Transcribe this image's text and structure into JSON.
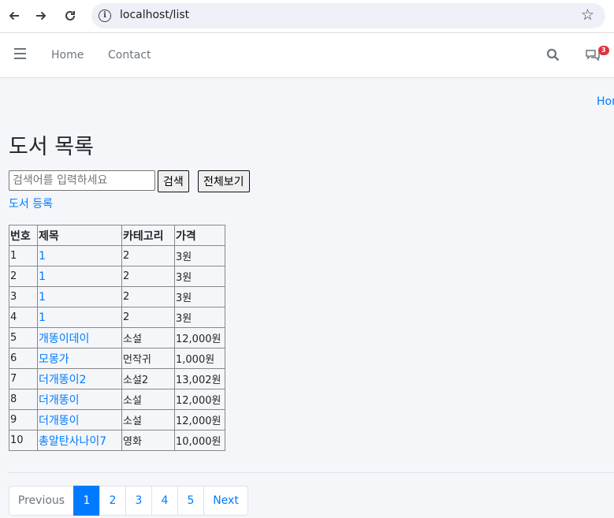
{
  "browser": {
    "url": "localhost/list"
  },
  "navbar": {
    "links": [
      "Home",
      "Contact"
    ],
    "notification_count": "3"
  },
  "breadcrumb": {
    "home": "Hom"
  },
  "page": {
    "title": "도서 목록",
    "search_placeholder": "검색어를 입력하세요",
    "search_button": "검색",
    "show_all_button": "전체보기",
    "register_link": "도서 등록"
  },
  "table": {
    "headers": [
      "번호",
      "제목",
      "카테고리",
      "가격"
    ],
    "rows": [
      {
        "no": "1",
        "title": "1",
        "category": "2",
        "price": "3원"
      },
      {
        "no": "2",
        "title": "1",
        "category": "2",
        "price": "3원"
      },
      {
        "no": "3",
        "title": "1",
        "category": "2",
        "price": "3원"
      },
      {
        "no": "4",
        "title": "1",
        "category": "2",
        "price": "3원"
      },
      {
        "no": "5",
        "title": "개똥이데이",
        "category": "소설",
        "price": "12,000원"
      },
      {
        "no": "6",
        "title": "모몽가",
        "category": "먼작귀",
        "price": "1,000원"
      },
      {
        "no": "7",
        "title": "더개똥이2",
        "category": "소설2",
        "price": "13,002원"
      },
      {
        "no": "8",
        "title": "더개똥이",
        "category": "소설",
        "price": "12,000원"
      },
      {
        "no": "9",
        "title": "더개똥이",
        "category": "소설",
        "price": "12,000원"
      },
      {
        "no": "10",
        "title": "총알탄사나이7",
        "category": "영화",
        "price": "10,000원"
      }
    ]
  },
  "pagination": {
    "previous": "Previous",
    "pages": [
      "1",
      "2",
      "3",
      "4",
      "5"
    ],
    "active_page": "1",
    "next": "Next"
  }
}
